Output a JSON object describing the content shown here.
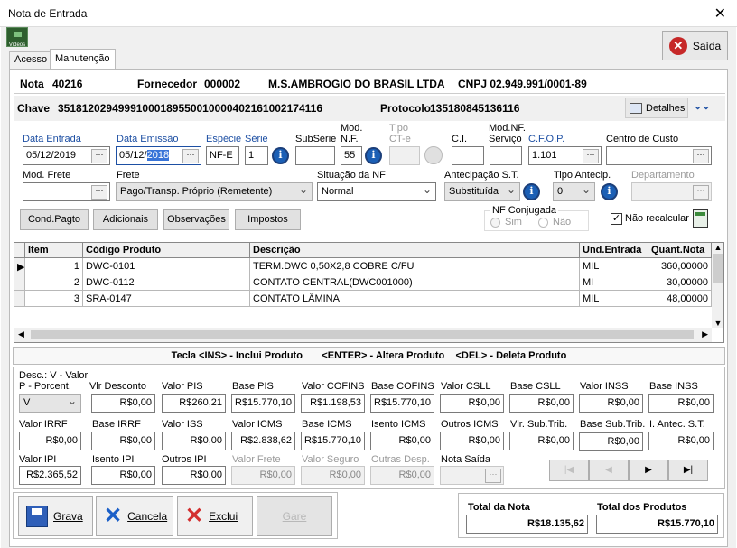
{
  "window": {
    "title": "Nota de Entrada",
    "close": "✕"
  },
  "toolbar": {
    "videos_label": "Videos",
    "exit_label": "Saída"
  },
  "tabs": [
    "Acesso",
    "Manutenção"
  ],
  "header": {
    "nota_label": "Nota",
    "nota": "40216",
    "fornecedor_label": "Fornecedor",
    "fornecedor_code": "000002",
    "fornecedor_name": "M.S.AMBROGIO DO BRASIL LTDA",
    "cnpj": "CNPJ 02.949.991/0001-89",
    "chave_label": "Chave",
    "chave": "35181202949991000189550010000402161002174116",
    "protocolo_label": "Protocolo",
    "protocolo": "135180845136116",
    "detalhes": "Detalhes"
  },
  "fields": {
    "data_entrada_label": "Data Entrada",
    "data_entrada": "05/12/2019",
    "data_emissao_label": "Data Emissão",
    "data_emissao_a": "05/12/",
    "data_emissao_b": "2018",
    "especie_label": "Espécie",
    "especie": "NF-E",
    "serie_label": "Série",
    "serie": "1",
    "subserie_label": "SubSérie",
    "subserie": "",
    "modnf_label1": "Mod.",
    "modnf_label2": "N.F.",
    "modnf": "55",
    "tipocte_label1": "Tipo",
    "tipocte_label2": "CT-e",
    "ci_label": "C.I.",
    "ci": "",
    "modnfserv_label1": "Mod.NF.",
    "modnfserv_label2": "Serviço",
    "cfop_label": "C.F.O.P.",
    "cfop": "1.101",
    "centro_label": "Centro de Custo",
    "centro": "",
    "modfrete_label": "Mod. Frete",
    "modfrete": "",
    "frete_label": "Frete",
    "frete": "Pago/Transp. Próprio (Remetente)",
    "situacao_label": "Situação da NF",
    "situacao": "Normal",
    "antecip_label": "Antecipação S.T.",
    "antecip": "Substituída",
    "tipoantecip_label": "Tipo Antecip.",
    "tipoantecip": "0",
    "departamento_label": "Departamento",
    "departamento": ""
  },
  "buttons": {
    "cond_pagto": "Cond.Pagto",
    "adicionais": "Adicionais",
    "observacoes": "Observações",
    "impostos": "Impostos"
  },
  "nf_conjugada": {
    "label": "NF Conjugada",
    "sim": "Sim",
    "nao": "Não"
  },
  "nao_recalcular": "Não recalcular",
  "grid": {
    "columns": [
      "Item",
      "Código Produto",
      "Descrição",
      "Und.Entrada",
      "Quant.Nota"
    ],
    "rows": [
      {
        "item": "1",
        "codigo": "DWC-0101",
        "descricao": "TERM.DWC 0,50X2,8 COBRE C/FU",
        "und": "MIL",
        "quant": "360,00000"
      },
      {
        "item": "2",
        "codigo": "DWC-0112",
        "descricao": "CONTATO CENTRAL(DWC001000)",
        "und": "MI",
        "quant": "30,00000"
      },
      {
        "item": "3",
        "codigo": "SRA-0147",
        "descricao": "CONTATO LÂMINA",
        "und": "MIL",
        "quant": "48,00000"
      }
    ]
  },
  "hint": "Tecla <INS> - Inclui Produto       <ENTER> - Altera Produto    <DEL> - Deleta Produto",
  "totals": {
    "desc_label1": "Desc.: V - Valor",
    "desc_label2": "P - Porcent.",
    "desc_value": "V",
    "vlr_desconto_label": "Vlr Desconto",
    "vlr_desconto": "R$0,00",
    "valor_pis_label": "Valor PIS",
    "valor_pis": "R$260,21",
    "base_pis_label": "Base PIS",
    "base_pis": "R$15.770,10",
    "valor_cofins_label": "Valor COFINS",
    "valor_cofins": "R$1.198,53",
    "base_cofins_label": "Base COFINS",
    "base_cofins": "R$15.770,10",
    "valor_csll_label": "Valor CSLL",
    "valor_csll": "R$0,00",
    "base_csll_label": "Base CSLL",
    "base_csll": "R$0,00",
    "valor_inss_label": "Valor INSS",
    "valor_inss": "R$0,00",
    "base_inss_label": "Base INSS",
    "base_inss": "R$0,00",
    "valor_irrf_label": "Valor IRRF",
    "valor_irrf": "R$0,00",
    "base_irrf_label": "Base IRRF",
    "base_irrf": "R$0,00",
    "valor_iss_label": "Valor ISS",
    "valor_iss": "R$0,00",
    "valor_icms_label": "Valor ICMS",
    "valor_icms": "R$2.838,62",
    "base_icms_label": "Base ICMS",
    "base_icms": "R$15.770,10",
    "isento_icms_label": "Isento ICMS",
    "isento_icms": "R$0,00",
    "outros_icms_label": "Outros ICMS",
    "outros_icms": "R$0,00",
    "vlr_subtrib_label": "Vlr. Sub.Trib.",
    "vlr_subtrib": "R$0,00",
    "base_subtrib_label": "Base Sub.Trib.",
    "base_subtrib": "R$0,00",
    "antec_st_label": "I. Antec. S.T.",
    "antec_st": "R$0,00",
    "valor_ipi_label": "Valor IPI",
    "valor_ipi": "R$2.365,52",
    "isento_ipi_label": "Isento IPI",
    "isento_ipi": "R$0,00",
    "outros_ipi_label": "Outros IPI",
    "outros_ipi": "R$0,00",
    "valor_frete_label": "Valor Frete",
    "valor_frete": "R$0,00",
    "valor_seguro_label": "Valor Seguro",
    "valor_seguro": "R$0,00",
    "outras_desp_label": "Outras Desp.",
    "outras_desp": "R$0,00",
    "nota_saida_label": "Nota Saída",
    "nota_saida": ""
  },
  "summary": {
    "total_nota_label": "Total da Nota",
    "total_nota": "R$18.135,62",
    "total_produtos_label": "Total dos Produtos",
    "total_produtos": "R$15.770,10"
  },
  "actions": {
    "grava": "Grava",
    "cancela": "Cancela",
    "exclui": "Exclui",
    "gare": "Gare"
  }
}
